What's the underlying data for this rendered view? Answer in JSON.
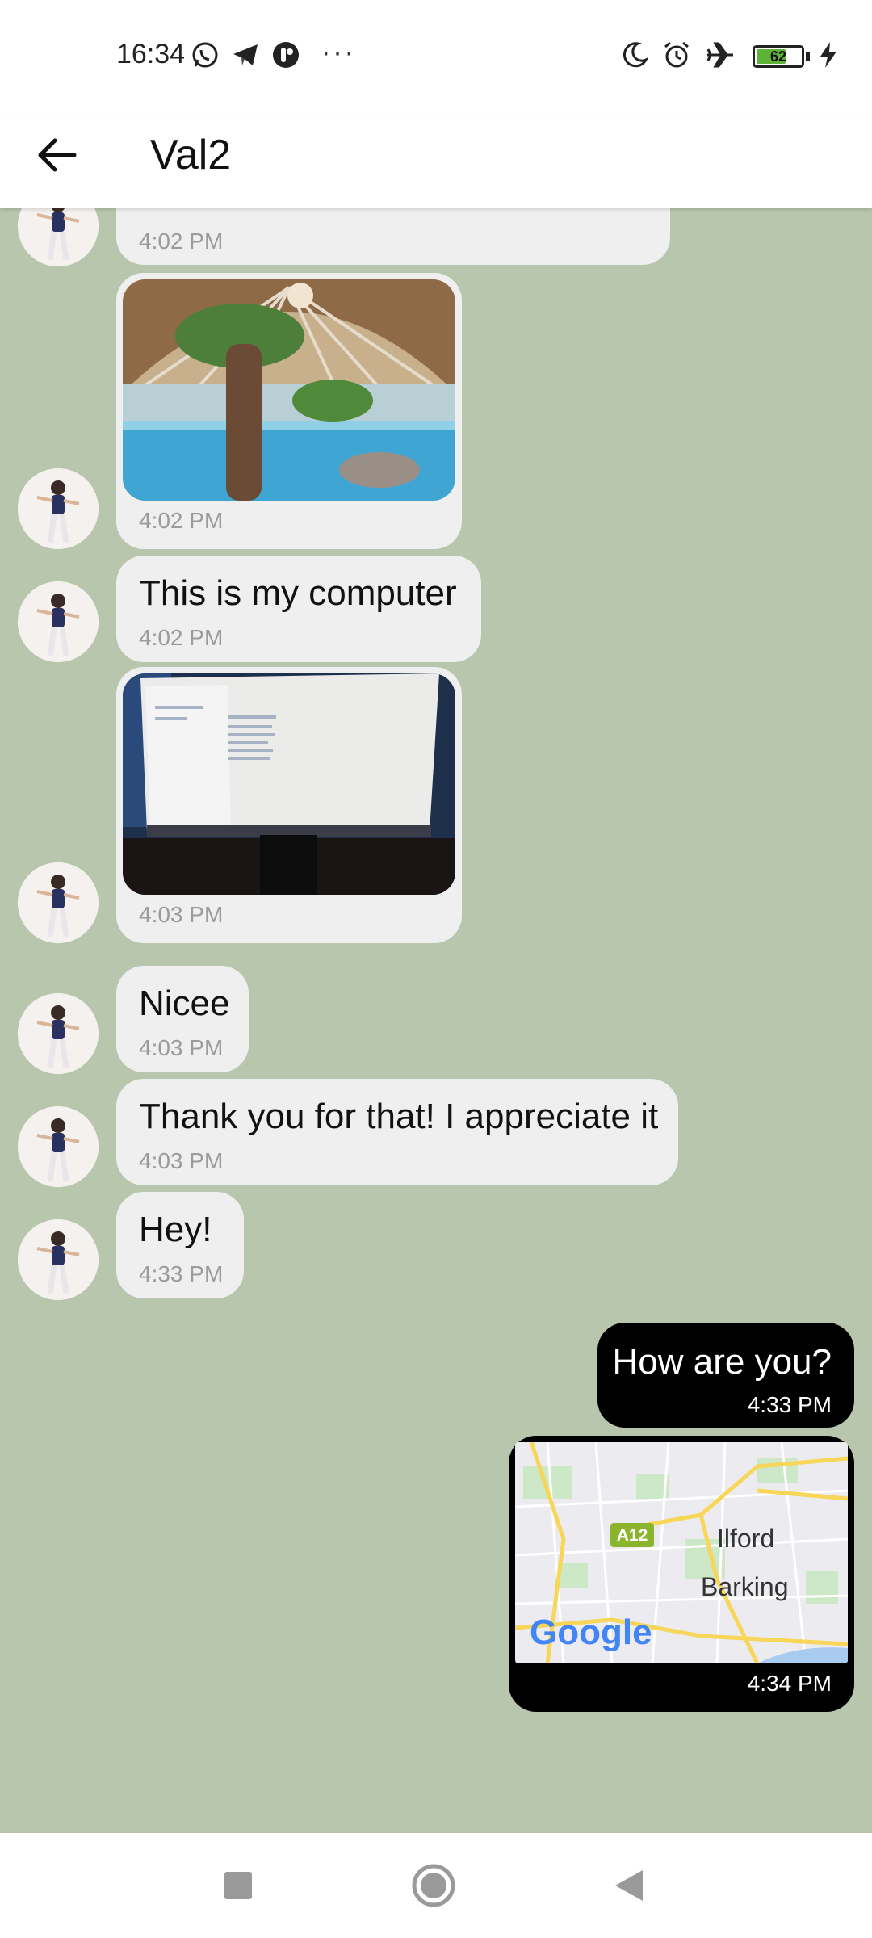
{
  "status_bar": {
    "time": "16:34",
    "battery_level": "62",
    "icons_left": [
      "whatsapp-icon",
      "telegram-icon",
      "app-icon",
      "more-dots"
    ],
    "icons_right": [
      "do-not-disturb-icon",
      "alarm-icon",
      "airplane-mode-icon",
      "battery-icon",
      "charging-icon"
    ]
  },
  "header": {
    "title": "Val2",
    "back_icon": "arrow-left-icon"
  },
  "messages": [
    {
      "direction": "in",
      "type": "text",
      "text": "",
      "time": "4:02 PM",
      "partially_hidden": true
    },
    {
      "direction": "in",
      "type": "photo",
      "photo": "indoor water park under dome",
      "time": "4:02 PM"
    },
    {
      "direction": "in",
      "type": "text",
      "text": "This is my computer",
      "time": "4:02 PM"
    },
    {
      "direction": "in",
      "type": "photo",
      "photo": "computer monitor",
      "time": "4:03 PM"
    },
    {
      "direction": "in",
      "type": "text",
      "text": "Nicee",
      "time": "4:03 PM"
    },
    {
      "direction": "in",
      "type": "text",
      "text": "Thank you for that! I appreciate it",
      "time": "4:03 PM"
    },
    {
      "direction": "in",
      "type": "text",
      "text": "Hey!",
      "time": "4:33 PM"
    },
    {
      "direction": "out",
      "type": "text",
      "text": "How are you?",
      "time": "4:33 PM"
    },
    {
      "direction": "out",
      "type": "map",
      "time": "4:34 PM",
      "map": {
        "road_label": "A12",
        "place_1": "Ilford",
        "place_2": "Barking",
        "provider": "Google"
      }
    }
  ],
  "colors": {
    "chat_background": "#b7c6ad",
    "incoming_bubble": "#efefef",
    "outgoing_bubble": "#000000",
    "timestamp": "#9b9b9b"
  },
  "nav": {
    "icons": [
      "recents-square-icon",
      "home-circle-icon",
      "back-triangle-icon"
    ]
  }
}
